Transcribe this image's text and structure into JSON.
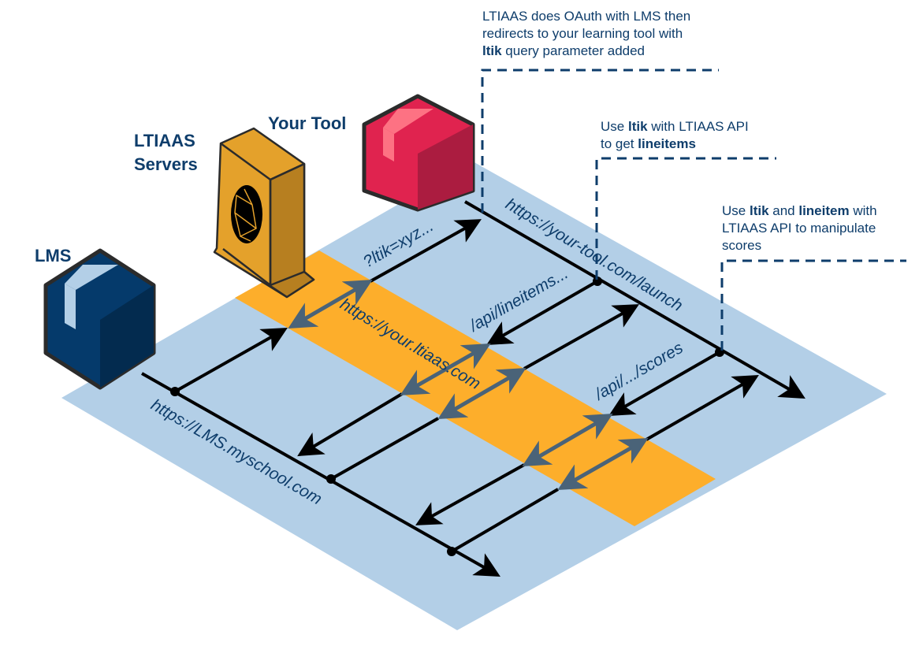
{
  "colors": {
    "plane": "#b3cfe7",
    "band": "#fdae2b",
    "navy": "#0e3d6b",
    "arrow_gray": "#4a6378",
    "tool": "#e0234f",
    "lms": "#053a6b",
    "server": "#e4a12b"
  },
  "nodes": {
    "lms": "LMS",
    "servers_line1": "LTIAAS",
    "servers_line2": "Servers",
    "tool": "Your Tool"
  },
  "urls": {
    "lms": "https://LMS.myschool.com",
    "ltiaas": "https://your.ltiaas.com",
    "tool": "https://your-tool.com/launch",
    "ltik": "?ltik=xyz...",
    "lineitems": "/api/lineitems...",
    "scores": "/api/.../scores"
  },
  "notes": {
    "n1": {
      "a": "LTIAAS does OAuth with LMS then",
      "b": "redirects to your learning tool with",
      "c_bold": "ltik",
      "c": " query parameter added"
    },
    "n2": {
      "a": "Use ",
      "a_bold": "ltik",
      "a2": " with LTIAAS API",
      "b": "to get ",
      "b_bold": "lineitems"
    },
    "n3": {
      "a": "Use ",
      "a_bold": "ltik",
      "a2": " and ",
      "a_bold2": "lineitem",
      "a3": " with",
      "b": "LTIAAS API to manipulate",
      "c": "scores"
    }
  }
}
